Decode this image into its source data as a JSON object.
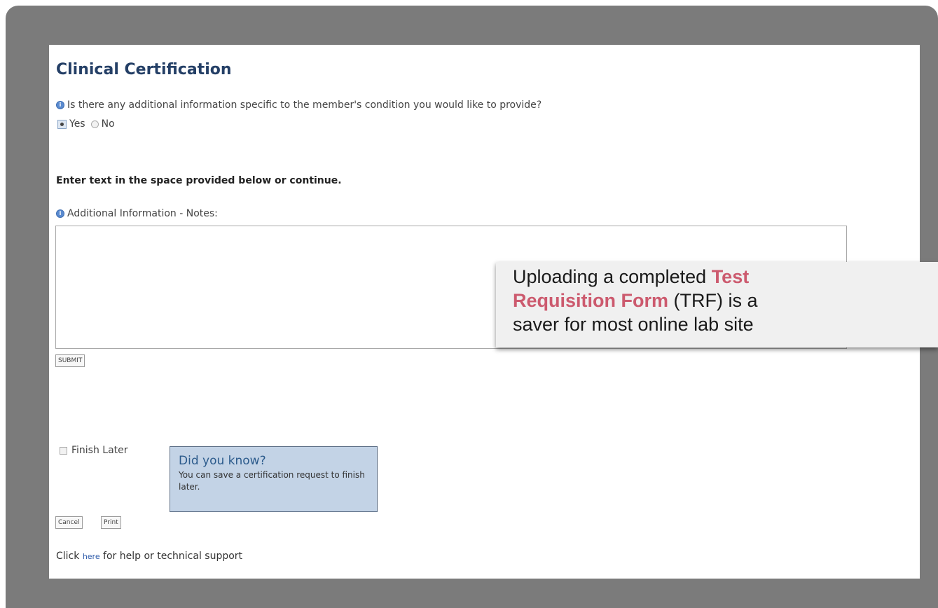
{
  "form": {
    "title": "Clinical Certification",
    "question": "Is there any additional information specific to the member's condition you would like to provide?",
    "options": [
      "Yes",
      "No"
    ],
    "selected": "Yes",
    "instruction": "Enter text in the space provided below or continue.",
    "notes_label": "Additional Information - Notes:",
    "notes_value": "",
    "submit_label": "SUBMIT",
    "finish_later_label": "Finish Later",
    "cancel_label": "Cancel",
    "print_label": "Print"
  },
  "tip": {
    "title": "Did you know?",
    "text": "You can save a certification request to finish later."
  },
  "help": {
    "prefix": "Click ",
    "link": "here",
    "suffix": " for help or technical support"
  },
  "callout": {
    "line1_pre": "Uploading a completed ",
    "line1_hl": "Test",
    "line2_hl": "Requisition Form",
    "line2_post": " (TRF) is a",
    "line3": "saver for most online lab site"
  },
  "colors": {
    "frame": "#7b7b7b",
    "title": "#243f66",
    "tip_bg": "#c3d3e6",
    "callout_highlight": "#cc5a6e"
  }
}
